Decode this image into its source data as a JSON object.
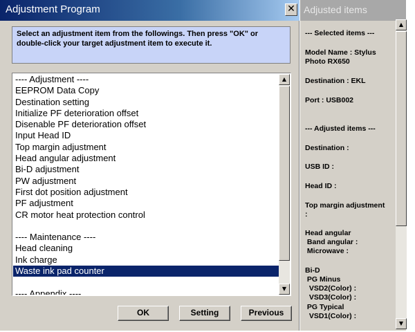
{
  "window": {
    "title": "Adjustment Program",
    "close_label": "✕"
  },
  "instructions": "Select an adjustment item from the followings. Then press \"OK\" or double-click your target adjustment item to execute it.",
  "list": {
    "items": [
      "---- Adjustment ----",
      "EEPROM Data Copy",
      "Destination setting",
      "Initialize PF deterioration offset",
      "Disenable PF deterioration offset",
      "Input Head ID",
      "Top margin adjustment",
      "Head angular adjustment",
      "Bi-D adjustment",
      "PW adjustment",
      "First dot position adjustment",
      "PF adjustment",
      "CR motor heat protection control",
      "",
      "---- Maintenance ----",
      "Head cleaning",
      "Ink charge",
      "Waste ink pad counter",
      "",
      "---- Appendix ----"
    ],
    "selected_item": "Waste ink pad counter"
  },
  "scrollbar": {
    "up_arrow": "▲",
    "down_arrow": "▼"
  },
  "buttons": {
    "ok": "OK",
    "setting": "Setting",
    "previous": "Previous"
  },
  "panel": {
    "title": "Adjusted items",
    "lines": [
      "--- Selected items ---",
      "Model Name : Stylus",
      "Photo RX650",
      "Destination : EKL",
      "Port : USB002",
      "--- Adjusted items ---",
      "Destination :",
      "USB ID :",
      "Head ID :",
      "Top margin adjustment",
      ":",
      "Head angular",
      " Band angular :",
      " Microwave :",
      "Bi-D",
      " PG Minus",
      "  VSD2(Color) :",
      "  VSD3(Color) :",
      " PG Typical",
      "  VSD1(Color) :"
    ]
  },
  "colors": {
    "titlebar_start": "#0a246a",
    "selection": "#0a246a",
    "instructions_bg": "#c8d4f8",
    "dialog_bg": "#d4d0c8"
  }
}
